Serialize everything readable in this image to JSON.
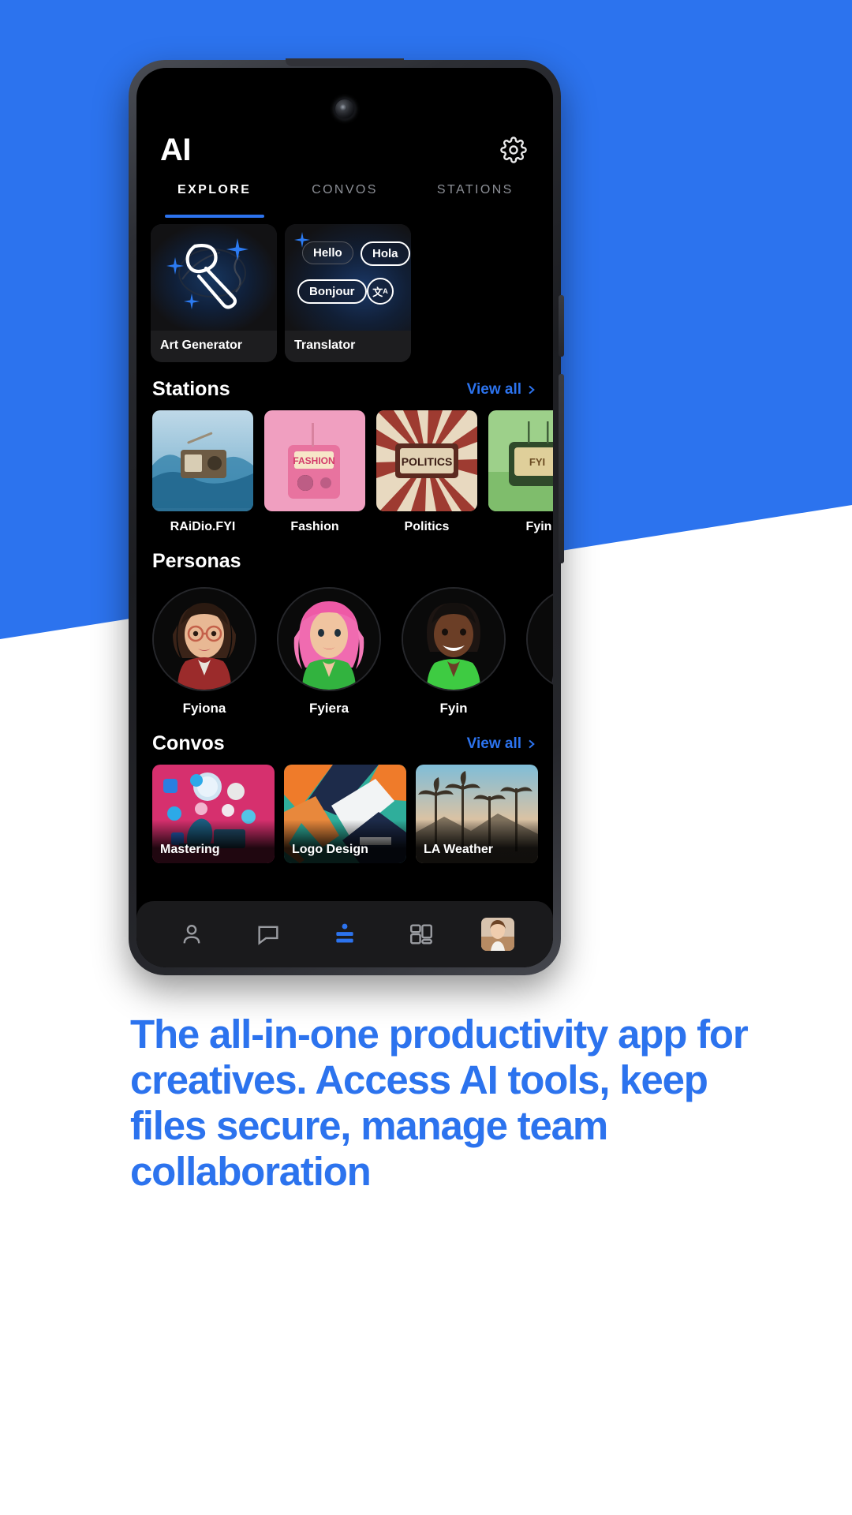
{
  "theme": {
    "brand_blue": "#2c73ee",
    "screen_bg": "#000000",
    "card_bg": "#161618",
    "nav_bg": "#1a1a1c",
    "muted_text": "#8c8f96"
  },
  "phone": {
    "camera_icon": "front-camera",
    "speaker_icon": "earpiece-speaker"
  },
  "header": {
    "title": "AI",
    "settings_icon": "gear-icon"
  },
  "tabs": [
    {
      "label": "EXPLORE",
      "active": true
    },
    {
      "label": "CONVOS",
      "active": false
    },
    {
      "label": "STATIONS",
      "active": false
    }
  ],
  "features": [
    {
      "label": "Art Generator",
      "icon": "paintbrush-icon"
    },
    {
      "label": "Translator",
      "icon": "translate-icon",
      "chips": [
        "Hello",
        "Hola",
        "Bonjour"
      ],
      "chip_icon": "language-swap-icon"
    }
  ],
  "stations": {
    "title": "Stations",
    "view_all": "View all",
    "chevron_icon": "chevron-right-icon",
    "items": [
      {
        "name": "RAiDio.FYI",
        "art": "radio-water-splash"
      },
      {
        "name": "Fashion",
        "art": "pink-fashion-radio"
      },
      {
        "name": "Politics",
        "art": "politics-retro-tv"
      },
      {
        "name": "Fyin",
        "art": "green-retro-tv"
      }
    ]
  },
  "personas": {
    "title": "Personas",
    "items": [
      {
        "name": "Fyiona",
        "avatar": "woman-bob-glasses-red"
      },
      {
        "name": "Fyiera",
        "avatar": "woman-pink-hair-green"
      },
      {
        "name": "Fyin",
        "avatar": "man-smiling-green-hoodie"
      },
      {
        "name": "",
        "avatar": "partial-avatar"
      }
    ]
  },
  "convos": {
    "title": "Convos",
    "view_all": "View all",
    "chevron_icon": "chevron-right-icon",
    "items": [
      {
        "name": "Mastering",
        "art": "social-media-pink"
      },
      {
        "name": "Logo Design",
        "art": "abstract-geometric"
      },
      {
        "name": "LA Weather",
        "art": "palm-trees-sunset"
      }
    ]
  },
  "bottom_nav": [
    {
      "icon": "person-icon",
      "active": false
    },
    {
      "icon": "chat-bubble-icon",
      "active": false
    },
    {
      "icon": "stations-icon",
      "active": true
    },
    {
      "icon": "dashboard-grid-icon",
      "active": false
    },
    {
      "icon": "profile-avatar",
      "active": false
    }
  ],
  "tagline": "The all-in-one productivity app for creatives. Access AI tools, keep files secure, manage team collaboration"
}
